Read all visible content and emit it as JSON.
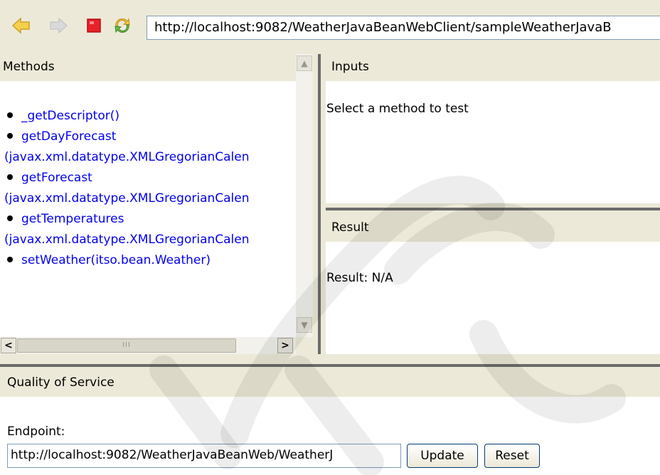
{
  "toolbar": {
    "icons": [
      "back-arrow-icon",
      "forward-arrow-icon",
      "stop-icon",
      "refresh-icon"
    ],
    "address": "http://localhost:9082/WeatherJavaBeanWebClient/sampleWeatherJavaB"
  },
  "methods": {
    "title": "Methods",
    "items": [
      {
        "line1": "_getDescriptor()",
        "line2": ""
      },
      {
        "line1": "getDayForecast",
        "line2": "(javax.xml.datatype.XMLGregorianCalen"
      },
      {
        "line1": "getForecast",
        "line2": "(javax.xml.datatype.XMLGregorianCalen"
      },
      {
        "line1": "getTemperatures",
        "line2": "(javax.xml.datatype.XMLGregorianCalen"
      },
      {
        "line1": "setWeather(itso.bean.Weather)",
        "line2": ""
      }
    ]
  },
  "inputs": {
    "title": "Inputs",
    "message": "Select a method to test"
  },
  "result": {
    "title": "Result",
    "message": "Result: N/A"
  },
  "qos": {
    "title": "Quality of Service",
    "endpoint_label": "Endpoint:",
    "endpoint_value": "http://localhost:9082/WeatherJavaBeanWeb/WeatherJ",
    "update_label": "Update",
    "reset_label": "Reset"
  },
  "colors": {
    "link": "#0000ee",
    "frame": "#ece9d8",
    "stop": "#e8202a"
  }
}
